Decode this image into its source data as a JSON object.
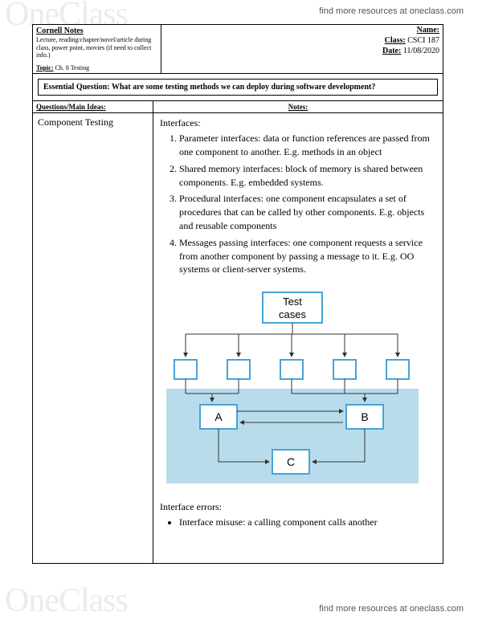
{
  "brand": "OneClass",
  "header_link": "find more resources at oneclass.com",
  "footer_link": "find more resources at oneclass.com",
  "cornell": {
    "title": "Cornell Notes",
    "subtitle": "Lecture, reading/chapter/novel/article during class, power point, movies (if need to collect info.)",
    "topic_label": "Topic:",
    "topic_value": "Ch. 8 Testing",
    "name_label": "Name:",
    "name_value": "",
    "class_label": "Class:",
    "class_value": "CSCI 187",
    "date_label": "Date:",
    "date_value": "11/08/2020"
  },
  "essential_question": "Essential Question: What are some testing methods we can deploy during software development?",
  "columns": {
    "left_header": "Questions/Main Ideas:",
    "right_header": "Notes:"
  },
  "main_idea": "Component Testing",
  "notes": {
    "interfaces_heading": "Interfaces:",
    "items": [
      "Parameter interfaces: data or function references are passed from one component to another. E.g. methods in an object",
      "Shared memory interfaces: block of memory is shared between components. E.g. embedded systems.",
      "Procedural interfaces: one component encapsulates a set of procedures that can be called by other components. E.g. objects and reusable components",
      "Messages passing interfaces: one component requests a service from another component by passing a message to it. E.g. OO systems or client-server systems."
    ],
    "errors_heading": "Interface errors:",
    "errors": [
      "Interface misuse: a calling component calls another"
    ]
  },
  "diagram": {
    "test_cases_label": "Test cases",
    "box_a": "A",
    "box_b": "B",
    "box_c": "C"
  }
}
